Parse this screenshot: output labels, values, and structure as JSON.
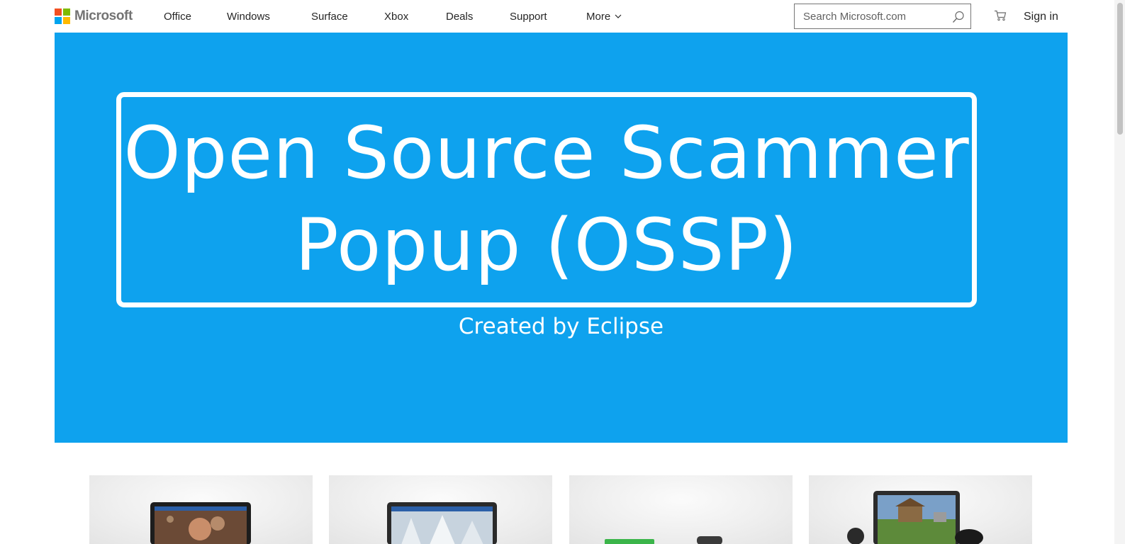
{
  "brand": {
    "name": "Microsoft",
    "logo_colors": [
      "#f25022",
      "#7fba00",
      "#00a4ef",
      "#ffb900"
    ]
  },
  "nav": {
    "items": [
      {
        "label": "Office"
      },
      {
        "label": "Windows"
      },
      {
        "label": "Surface"
      },
      {
        "label": "Xbox"
      },
      {
        "label": "Deals"
      },
      {
        "label": "Support"
      },
      {
        "label": "More"
      }
    ]
  },
  "search": {
    "placeholder": "Search Microsoft.com",
    "value": "",
    "icon": "search-icon"
  },
  "cart": {
    "icon": "cart-icon"
  },
  "account": {
    "signin_label": "Sign in"
  },
  "hero": {
    "title_line1": "Open Source Scammer",
    "title_line2": "Popup (OSSP)",
    "subtitle": "Created by Eclipse",
    "background_color": "#0ea2ee"
  },
  "tiles": [
    {
      "icon": "laptop-icon"
    },
    {
      "icon": "tablet-icon"
    },
    {
      "icon": "xbox-console-icon"
    },
    {
      "icon": "laptop-icon"
    }
  ]
}
